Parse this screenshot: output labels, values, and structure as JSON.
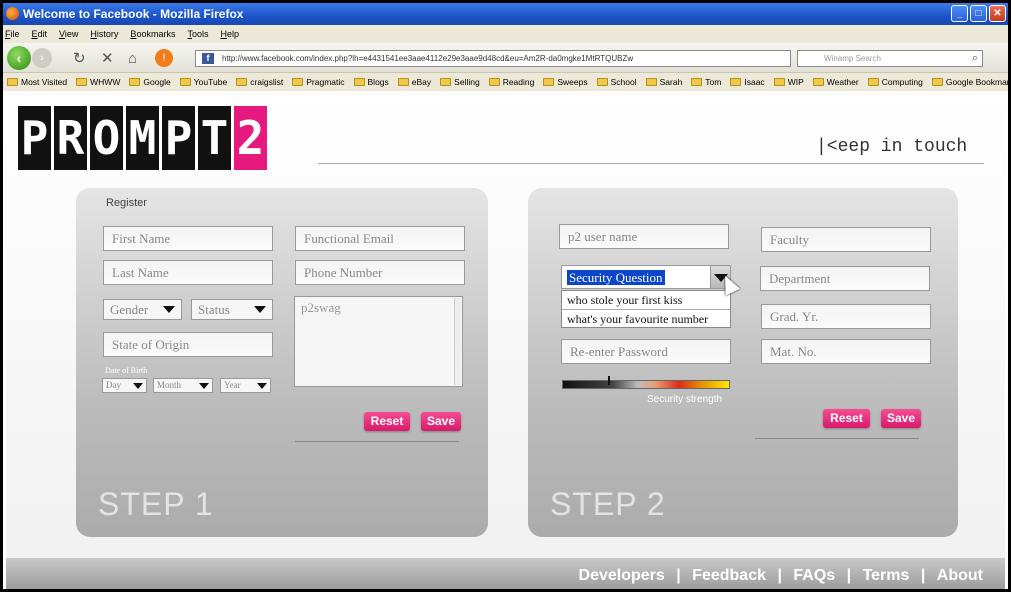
{
  "browser": {
    "title": "Welcome to Facebook - Mozilla Firefox",
    "menu": [
      "File",
      "Edit",
      "View",
      "History",
      "Bookmarks",
      "Tools",
      "Help"
    ],
    "url": "http://www.facebook.com/index.php?lh=e4431541ee3aae4112e29e3aae9d48cd&eu=Am2R-da0mgke1MtRTQUBZw",
    "search_placeholder": "Winamp Search",
    "bookmarks": [
      "Most Visited",
      "WHWW",
      "Google",
      "YouTube",
      "craigslist",
      "Pragmatic",
      "Blogs",
      "eBay",
      "Selling",
      "Reading",
      "Sweeps",
      "School",
      "Sarah",
      "Tom",
      "Isaac",
      "WIP",
      "Weather",
      "Computing",
      "Google Bookmark"
    ]
  },
  "logo": [
    "P",
    "R",
    "O",
    "M",
    "P",
    "T",
    "2"
  ],
  "tagline": "|<eep in touch",
  "step1": {
    "header": "Register",
    "first_name": "First Name",
    "last_name": "Last Name",
    "gender": "Gender",
    "status": "Status",
    "state": "State of Origin",
    "dob_label": "Date of Birth",
    "day": "Day",
    "month": "Month",
    "year": "Year",
    "email": "Functional Email",
    "phone": "Phone Number",
    "textarea": "p2swag",
    "reset": "Reset",
    "save": "Save",
    "step_label": "STEP 1"
  },
  "step2": {
    "username": "p2 user name",
    "security_question": "Security Question",
    "options": [
      "who stole your first kiss",
      "what's your favourite number"
    ],
    "reenter_password": "Re-enter Password",
    "strength_label": "Security strength",
    "faculty": "Faculty",
    "department": "Department",
    "grad_yr": "Grad. Yr.",
    "mat_no": "Mat. No.",
    "reset": "Reset",
    "save": "Save",
    "step_label": "STEP 2"
  },
  "footer": [
    "Developers",
    "|",
    "Feedback",
    "|",
    "FAQs",
    "|",
    "Terms",
    "|",
    "About"
  ]
}
